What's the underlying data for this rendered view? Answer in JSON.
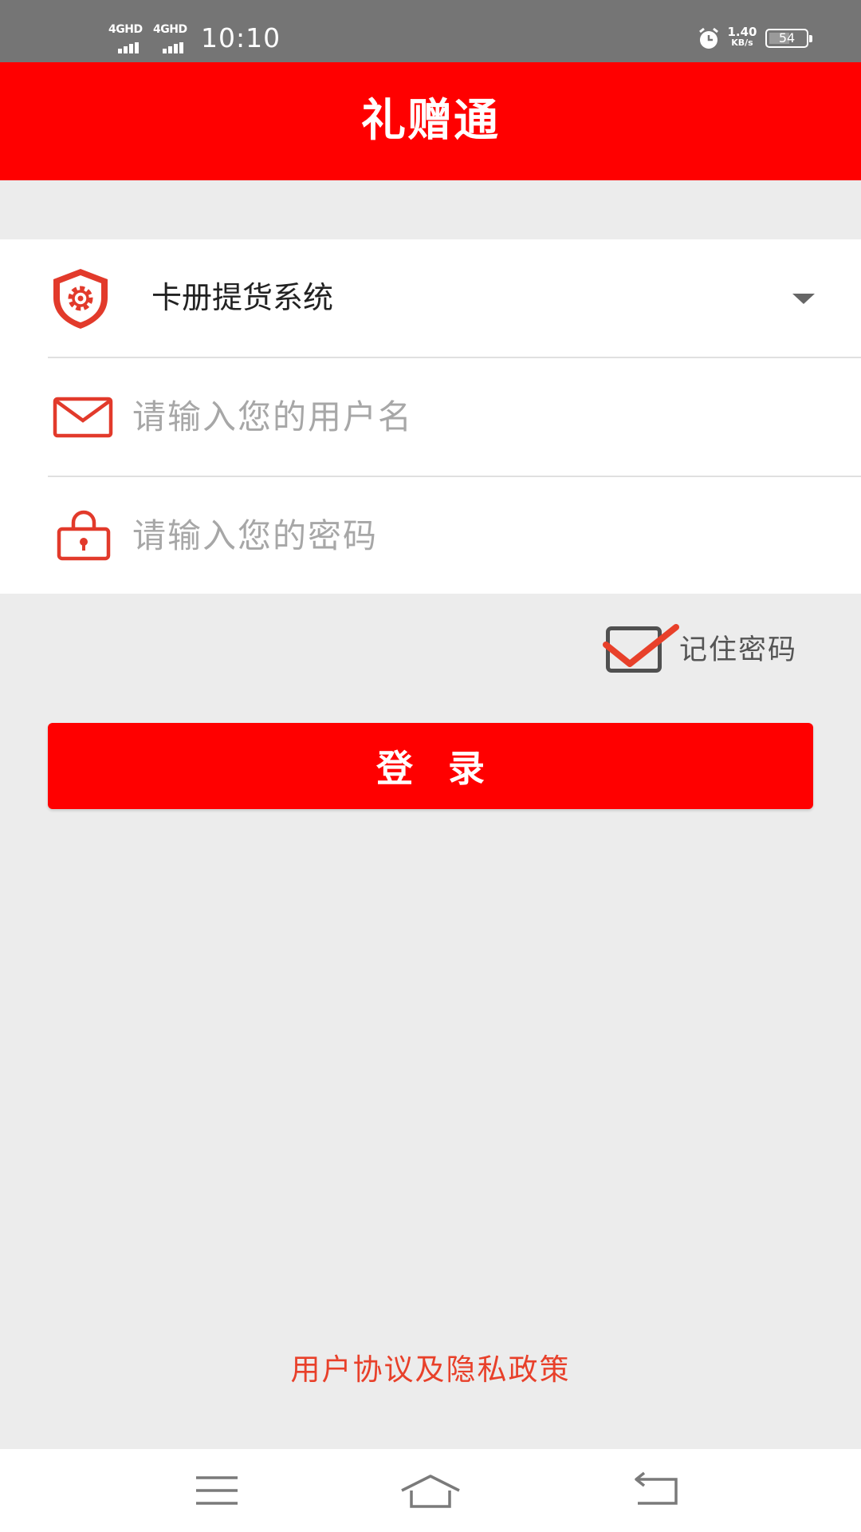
{
  "status_bar": {
    "network_1": "4GHD",
    "network_2": "4GHD",
    "time": "10:10",
    "speed_value": "1.40",
    "speed_unit": "KB/s",
    "battery_level": "54"
  },
  "app_bar": {
    "title": "礼赠通"
  },
  "form": {
    "system_selected": "卡册提货系统",
    "username_placeholder": "请输入您的用户名",
    "password_placeholder": "请输入您的密码"
  },
  "remember": {
    "label": "记住密码",
    "checked": true
  },
  "login_button": {
    "label": "登录"
  },
  "policy_link": {
    "label": "用户协议及隐私政策"
  },
  "colors": {
    "brand_red": "#ff0000",
    "link_red": "#e8402a",
    "background": "#ececec",
    "status_bar": "#757575"
  },
  "icons": {
    "system_select": "shield-gear-icon",
    "username": "mail-icon",
    "password": "lock-icon",
    "remember": "checkbox-checked-icon",
    "nav_menu": "menu-icon",
    "nav_home": "home-icon",
    "nav_back": "back-icon"
  }
}
